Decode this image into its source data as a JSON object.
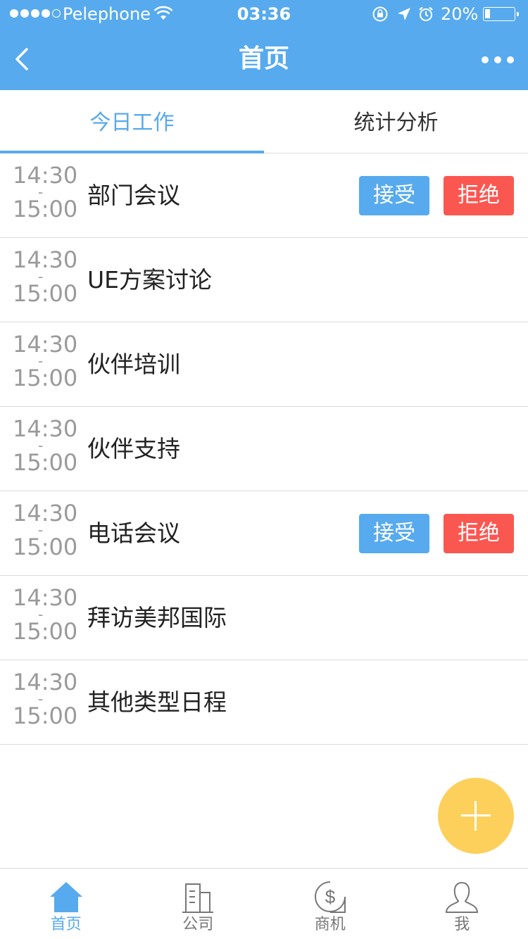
{
  "status_bar": {
    "carrier": "Pelephone",
    "time": "03:36",
    "battery": "20%",
    "battery_level": 0.2
  },
  "nav": {
    "title": "首页",
    "back_icon": "chevron-left-icon",
    "more_icon": "more-dots-icon"
  },
  "tabs": [
    {
      "label": "今日工作",
      "active": true
    },
    {
      "label": "统计分析",
      "active": false
    }
  ],
  "schedule": [
    {
      "start": "14:30",
      "sep": "-",
      "end": "15:00",
      "title": "部门会议",
      "has_actions": true
    },
    {
      "start": "14:30",
      "sep": "-",
      "end": "15:00",
      "title": "UE方案讨论",
      "has_actions": false
    },
    {
      "start": "14:30",
      "sep": "-",
      "end": "15:00",
      "title": "伙伴培训",
      "has_actions": false
    },
    {
      "start": "14:30",
      "sep": "-",
      "end": "15:00",
      "title": "伙伴支持",
      "has_actions": false
    },
    {
      "start": "14:30",
      "sep": "-",
      "end": "15:00",
      "title": "电话会议",
      "has_actions": true
    },
    {
      "start": "14:30",
      "sep": "-",
      "end": "15:00",
      "title": "拜访美邦国际",
      "has_actions": false
    },
    {
      "start": "14:30",
      "sep": "-",
      "end": "15:00",
      "title": "其他类型日程",
      "has_actions": false
    }
  ],
  "actions": {
    "accept": "接受",
    "reject": "拒绝"
  },
  "fab_icon": "plus-icon",
  "tabbar": [
    {
      "label": "首页",
      "icon": "home-icon",
      "active": true
    },
    {
      "label": "公司",
      "icon": "building-icon",
      "active": false
    },
    {
      "label": "商机",
      "icon": "dollar-icon",
      "active": false
    },
    {
      "label": "我",
      "icon": "user-icon",
      "active": false
    }
  ],
  "colors": {
    "primary": "#57aaed",
    "reject": "#fb5751",
    "fab": "#fdd05c",
    "muted": "#9a9a9a"
  }
}
